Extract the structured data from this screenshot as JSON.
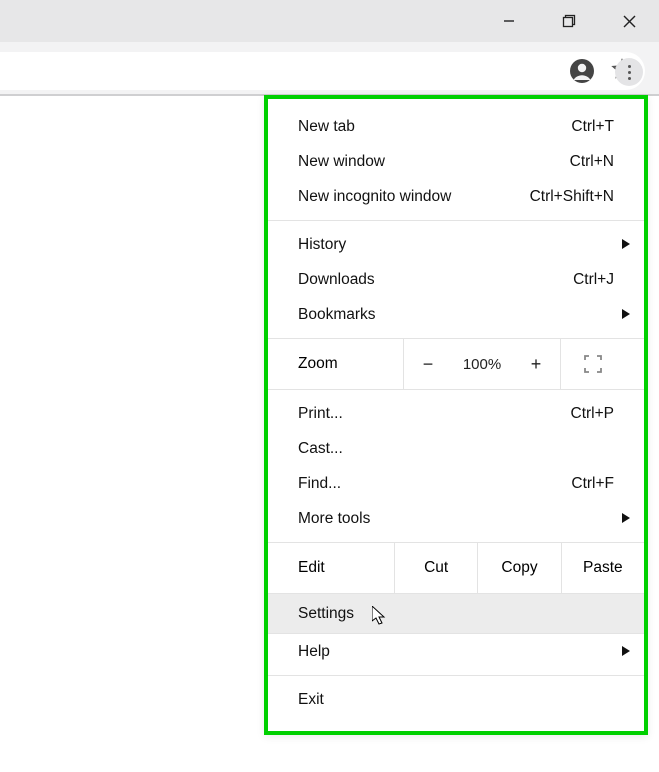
{
  "window": {
    "minimize_label": "Minimize",
    "restore_label": "Restore",
    "close_label": "Close"
  },
  "toolbar": {
    "star_label": "Bookmark",
    "avatar_label": "Account",
    "more_label": "More"
  },
  "menu": {
    "new_tab": {
      "label": "New tab",
      "shortcut": "Ctrl+T"
    },
    "new_window": {
      "label": "New window",
      "shortcut": "Ctrl+N"
    },
    "new_incognito": {
      "label": "New incognito window",
      "shortcut": "Ctrl+Shift+N"
    },
    "history": {
      "label": "History"
    },
    "downloads": {
      "label": "Downloads",
      "shortcut": "Ctrl+J"
    },
    "bookmarks": {
      "label": "Bookmarks"
    },
    "zoom": {
      "label": "Zoom",
      "value": "100%",
      "minus": "−",
      "plus": "+"
    },
    "print": {
      "label": "Print...",
      "shortcut": "Ctrl+P"
    },
    "cast": {
      "label": "Cast..."
    },
    "find": {
      "label": "Find...",
      "shortcut": "Ctrl+F"
    },
    "more_tools": {
      "label": "More tools"
    },
    "edit": {
      "label": "Edit",
      "cut": "Cut",
      "copy": "Copy",
      "paste": "Paste"
    },
    "settings": {
      "label": "Settings"
    },
    "help": {
      "label": "Help"
    },
    "exit": {
      "label": "Exit"
    }
  }
}
